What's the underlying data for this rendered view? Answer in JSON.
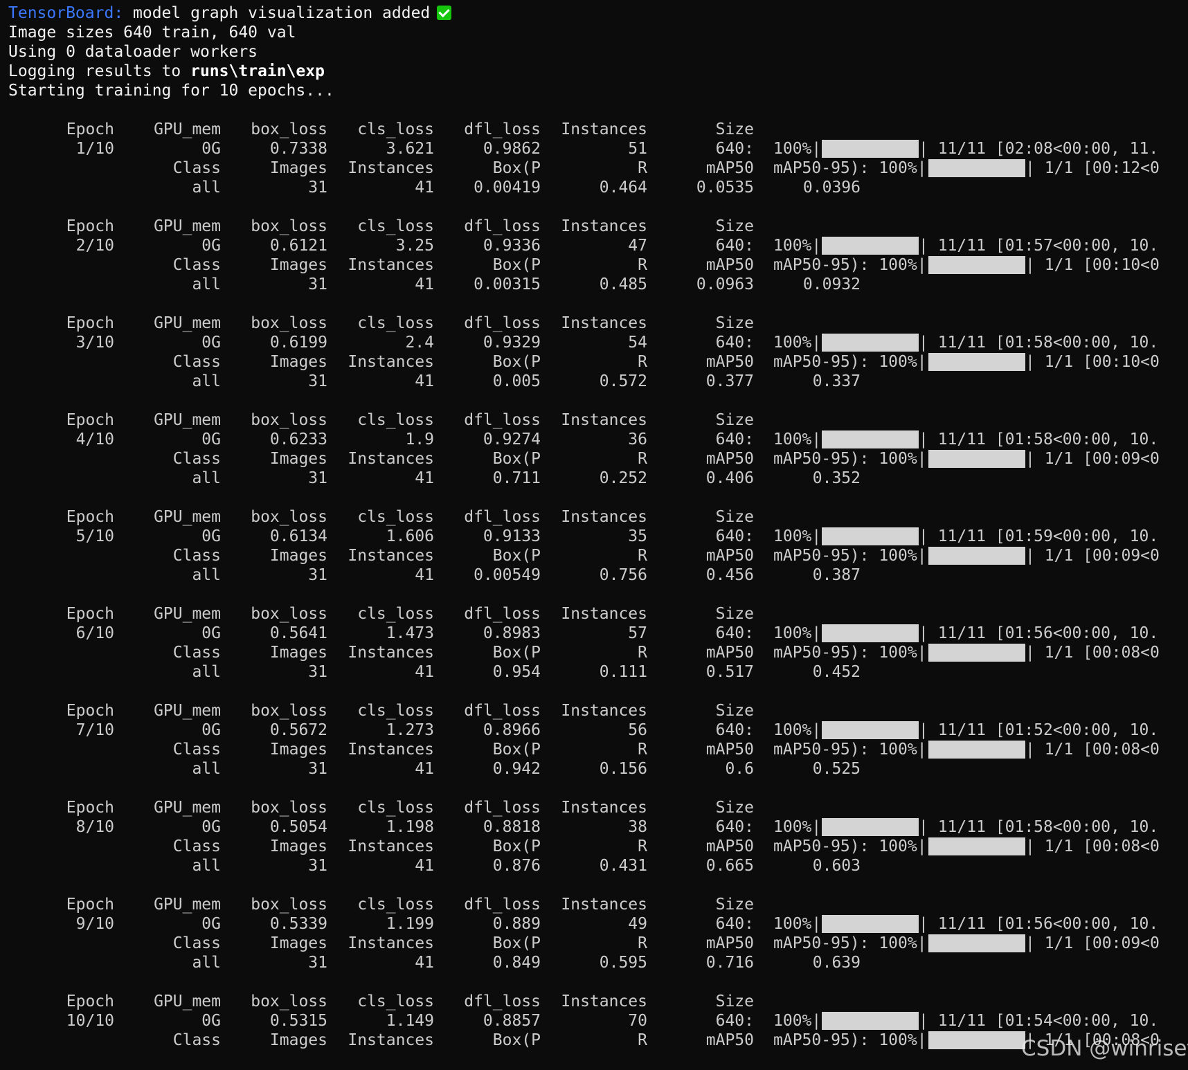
{
  "header_lines": {
    "tensorboard_label": "TensorBoard:",
    "tensorboard_msg": " model graph visualization added",
    "line2": "Image sizes 640 train, 640 val",
    "line3": "Using 0 dataloader workers",
    "line4_prefix": "Logging results to ",
    "line4_path": "runs\\train\\exp",
    "line5": "Starting training for 10 epochs..."
  },
  "icons": {
    "check": "white-heavy-check-mark-icon"
  },
  "colors": {
    "background": "#0c0c0c",
    "text": "#cccccc",
    "tensorboard_blue": "#3b78ff",
    "check_green": "#16c60c",
    "progress_bar": "#d4d4d4"
  },
  "train_headers": [
    "Epoch",
    "GPU_mem",
    "box_loss",
    "cls_loss",
    "dfl_loss",
    "Instances",
    "Size"
  ],
  "val_headers": [
    "Class",
    "Images",
    "Instances",
    "Box(P",
    "R",
    "mAP50",
    "mAP50-95): 100%|"
  ],
  "train_pct": "100%|",
  "epochs": [
    {
      "epoch": "1/10",
      "gpu_mem": "0G",
      "box_loss": "0.7338",
      "cls_loss": "3.621",
      "dfl_loss": "0.9862",
      "instances": "51",
      "size": "640:",
      "train_progress": 1.0,
      "train_tail": "| 11/11 [02:08<00:00, 11.",
      "val_progress": 1.0,
      "val_tail": "| 1/1 [00:12<0",
      "val": {
        "class": "all",
        "images": "31",
        "instances": "41",
        "box_p": "0.00419",
        "r": "0.464",
        "map50": "0.0535",
        "map50_95": "0.0396"
      }
    },
    {
      "epoch": "2/10",
      "gpu_mem": "0G",
      "box_loss": "0.6121",
      "cls_loss": "3.25",
      "dfl_loss": "0.9336",
      "instances": "47",
      "size": "640:",
      "train_progress": 1.0,
      "train_tail": "| 11/11 [01:57<00:00, 10.",
      "val_progress": 1.0,
      "val_tail": "| 1/1 [00:10<0",
      "val": {
        "class": "all",
        "images": "31",
        "instances": "41",
        "box_p": "0.00315",
        "r": "0.485",
        "map50": "0.0963",
        "map50_95": "0.0932"
      }
    },
    {
      "epoch": "3/10",
      "gpu_mem": "0G",
      "box_loss": "0.6199",
      "cls_loss": "2.4",
      "dfl_loss": "0.9329",
      "instances": "54",
      "size": "640:",
      "train_progress": 1.0,
      "train_tail": "| 11/11 [01:58<00:00, 10.",
      "val_progress": 1.0,
      "val_tail": "| 1/1 [00:10<0",
      "val": {
        "class": "all",
        "images": "31",
        "instances": "41",
        "box_p": "0.005",
        "r": "0.572",
        "map50": "0.377",
        "map50_95": "0.337"
      }
    },
    {
      "epoch": "4/10",
      "gpu_mem": "0G",
      "box_loss": "0.6233",
      "cls_loss": "1.9",
      "dfl_loss": "0.9274",
      "instances": "36",
      "size": "640:",
      "train_progress": 1.0,
      "train_tail": "| 11/11 [01:58<00:00, 10.",
      "val_progress": 1.0,
      "val_tail": "| 1/1 [00:09<0",
      "val": {
        "class": "all",
        "images": "31",
        "instances": "41",
        "box_p": "0.711",
        "r": "0.252",
        "map50": "0.406",
        "map50_95": "0.352"
      }
    },
    {
      "epoch": "5/10",
      "gpu_mem": "0G",
      "box_loss": "0.6134",
      "cls_loss": "1.606",
      "dfl_loss": "0.9133",
      "instances": "35",
      "size": "640:",
      "train_progress": 1.0,
      "train_tail": "| 11/11 [01:59<00:00, 10.",
      "val_progress": 1.0,
      "val_tail": "| 1/1 [00:09<0",
      "val": {
        "class": "all",
        "images": "31",
        "instances": "41",
        "box_p": "0.00549",
        "r": "0.756",
        "map50": "0.456",
        "map50_95": "0.387"
      }
    },
    {
      "epoch": "6/10",
      "gpu_mem": "0G",
      "box_loss": "0.5641",
      "cls_loss": "1.473",
      "dfl_loss": "0.8983",
      "instances": "57",
      "size": "640:",
      "train_progress": 1.0,
      "train_tail": "| 11/11 [01:56<00:00, 10.",
      "val_progress": 1.0,
      "val_tail": "| 1/1 [00:08<0",
      "val": {
        "class": "all",
        "images": "31",
        "instances": "41",
        "box_p": "0.954",
        "r": "0.111",
        "map50": "0.517",
        "map50_95": "0.452"
      }
    },
    {
      "epoch": "7/10",
      "gpu_mem": "0G",
      "box_loss": "0.5672",
      "cls_loss": "1.273",
      "dfl_loss": "0.8966",
      "instances": "56",
      "size": "640:",
      "train_progress": 1.0,
      "train_tail": "| 11/11 [01:52<00:00, 10.",
      "val_progress": 1.0,
      "val_tail": "| 1/1 [00:08<0",
      "val": {
        "class": "all",
        "images": "31",
        "instances": "41",
        "box_p": "0.942",
        "r": "0.156",
        "map50": "0.6",
        "map50_95": "0.525"
      }
    },
    {
      "epoch": "8/10",
      "gpu_mem": "0G",
      "box_loss": "0.5054",
      "cls_loss": "1.198",
      "dfl_loss": "0.8818",
      "instances": "38",
      "size": "640:",
      "train_progress": 1.0,
      "train_tail": "| 11/11 [01:58<00:00, 10.",
      "val_progress": 1.0,
      "val_tail": "| 1/1 [00:08<0",
      "val": {
        "class": "all",
        "images": "31",
        "instances": "41",
        "box_p": "0.876",
        "r": "0.431",
        "map50": "0.665",
        "map50_95": "0.603"
      }
    },
    {
      "epoch": "9/10",
      "gpu_mem": "0G",
      "box_loss": "0.5339",
      "cls_loss": "1.199",
      "dfl_loss": "0.889",
      "instances": "49",
      "size": "640:",
      "train_progress": 1.0,
      "train_tail": "| 11/11 [01:56<00:00, 10.",
      "val_progress": 1.0,
      "val_tail": "| 1/1 [00:09<0",
      "val": {
        "class": "all",
        "images": "31",
        "instances": "41",
        "box_p": "0.849",
        "r": "0.595",
        "map50": "0.716",
        "map50_95": "0.639"
      }
    },
    {
      "epoch": "10/10",
      "gpu_mem": "0G",
      "box_loss": "0.5315",
      "cls_loss": "1.149",
      "dfl_loss": "0.8857",
      "instances": "70",
      "size": "640:",
      "train_progress": 1.0,
      "train_tail": "| 11/11 [01:54<00:00, 10.",
      "val_progress": 1.0,
      "val_tail": "| 1/1 [00:08<0",
      "val": null
    }
  ],
  "watermark": "CSDN @winrisef"
}
